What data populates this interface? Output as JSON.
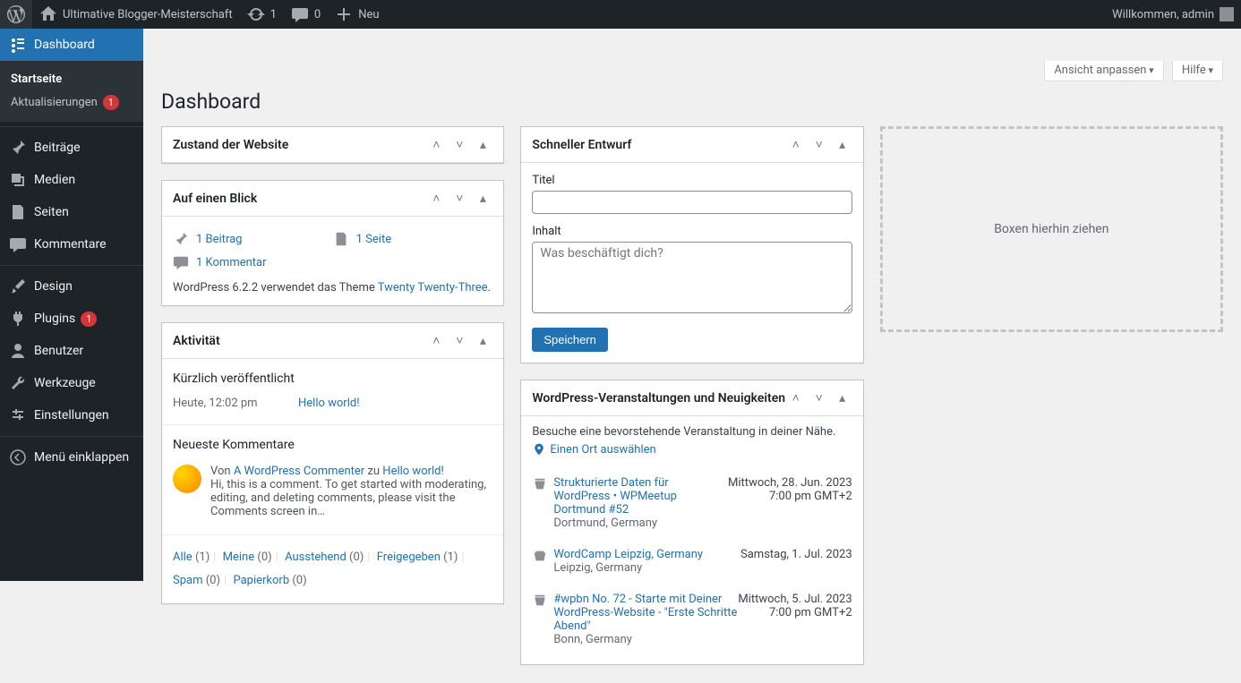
{
  "adminbar": {
    "site_title": "Ultimative Blogger-Meisterschaft",
    "updates": "1",
    "comments": "0",
    "new_label": "Neu",
    "welcome": "Willkommen, admin"
  },
  "sidebar": {
    "dashboard": "Dashboard",
    "home": "Startseite",
    "updates": "Aktualisierungen",
    "updates_badge": "1",
    "posts": "Beiträge",
    "media": "Medien",
    "pages": "Seiten",
    "comments": "Kommentare",
    "appearance": "Design",
    "plugins": "Plugins",
    "plugins_badge": "1",
    "users": "Benutzer",
    "tools": "Werkzeuge",
    "settings": "Einstellungen",
    "collapse": "Menü einklappen"
  },
  "screen_options": "Ansicht anpassen",
  "help": "Hilfe",
  "page_title": "Dashboard",
  "site_health": {
    "title": "Zustand der Website"
  },
  "glance": {
    "title": "Auf einen Blick",
    "post": "1 Beitrag",
    "page": "1 Seite",
    "comment": "1 Kommentar",
    "version_text": "WordPress 6.2.2 verwendet das Theme ",
    "theme": "Twenty Twenty-Three",
    "dot": "."
  },
  "activity": {
    "title": "Aktivität",
    "published_h": "Kürzlich veröffentlicht",
    "today_time": "Heute, 12:02 pm",
    "post_link": "Hello world!",
    "comments_h": "Neueste Kommentare",
    "by": "Von ",
    "commenter": "A WordPress Commenter",
    "to": " zu ",
    "on_post": "Hello world!",
    "comment_excerpt": "Hi, this is a comment. To get started with moderating, editing, and deleting comments, please visit the Comments screen in…",
    "filters": {
      "all": "Alle",
      "all_c": "(1)",
      "mine": "Meine",
      "mine_c": "(0)",
      "pending": "Ausstehend",
      "pending_c": "(0)",
      "approved": "Freigegeben",
      "approved_c": "(1)",
      "spam": "Spam",
      "spam_c": "(0)",
      "trash": "Papierkorb",
      "trash_c": "(0)"
    }
  },
  "quickdraft": {
    "title": "Schneller Entwurf",
    "title_label": "Titel",
    "content_label": "Inhalt",
    "placeholder": "Was beschäftigt dich?",
    "save": "Speichern"
  },
  "events": {
    "title": "WordPress-Veranstaltungen und Neuigkeiten",
    "intro": "Besuche eine bevorstehende Veranstaltung in deiner Nähe.",
    "pick_location": "Einen Ort auswählen",
    "items": [
      {
        "title": "Strukturierte Daten für WordPress • WPMeetup Dortmund #52",
        "loc": "Dortmund, Germany",
        "date": "Mittwoch, 28. Jun. 2023",
        "time": "7:00 pm GMT+2",
        "type": "meetup"
      },
      {
        "title": "WordCamp Leipzig, Germany",
        "loc": "Leipzig, Germany",
        "date": "Samstag, 1. Jul. 2023",
        "time": "",
        "type": "wordcamp"
      },
      {
        "title": "#wpbn No. 72 - Starte mit Deiner WordPress-Website - \"Erste Schritte Abend\"",
        "loc": "Bonn, Germany",
        "date": "Mittwoch, 5. Jul. 2023",
        "time": "7:00 pm GMT+2",
        "type": "meetup"
      }
    ]
  },
  "dropzone": "Boxen hierhin ziehen"
}
